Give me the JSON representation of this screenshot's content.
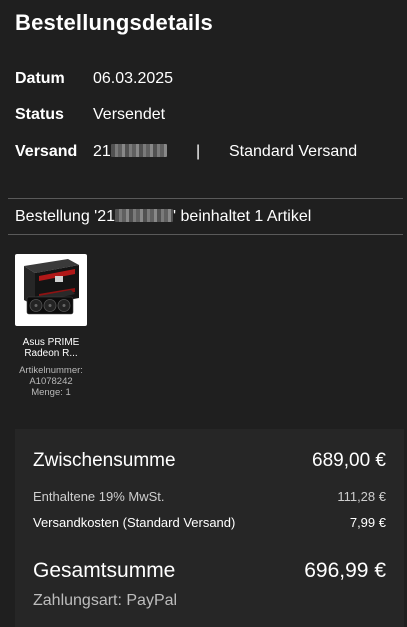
{
  "page": {
    "title": "Bestellungsdetails"
  },
  "details": {
    "date_label": "Datum",
    "date_value": "06.03.2025",
    "status_label": "Status",
    "status_value": "Versendet",
    "shipping_label": "Versand",
    "shipping_id_prefix": "21",
    "shipping_separator": "|",
    "shipping_method": "Standard Versand"
  },
  "order": {
    "text_prefix": "Bestellung '21",
    "text_suffix": "' beinhaltet 1 Artikel"
  },
  "product": {
    "name_line1": "Asus PRIME",
    "name_line2": "Radeon R...",
    "article_label": "Artikelnummer:",
    "article_number": "A1078242",
    "quantity": "Menge: 1"
  },
  "summary": {
    "subtotal_label": "Zwischensumme",
    "subtotal_value": "689,00 €",
    "vat_label": "Enthaltene 19% MwSt.",
    "vat_value": "111,28 €",
    "shipping_cost_label": "Versandkosten (Standard Versand)",
    "shipping_cost_value": "7,99 €",
    "total_label": "Gesamtsumme",
    "total_value": "696,99 €",
    "payment": "Zahlungsart: PayPal"
  },
  "colors": {
    "background": "#1f1f1f",
    "panel": "#262626",
    "text": "#ffffff",
    "muted": "#bdbdbd"
  }
}
